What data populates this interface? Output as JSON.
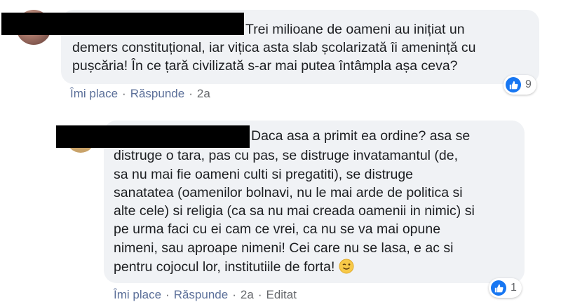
{
  "comments": [
    {
      "text_lines": [
        "Trei milioane de oameni au inițiat un",
        "demers constituțional, iar vițica asta slab școlarizată îi amenință cu",
        "pușcăria! În ce țară civilizată s-ar mai putea întâmpla așa ceva?"
      ],
      "like_label": "Îmi place",
      "reply_label": "Răspunde",
      "time": "2a",
      "reaction_count": "9",
      "reaction_icon": "like-icon"
    },
    {
      "text_lines": [
        "Daca asa a primit ea ordine? asa se",
        "distruge o tara, pas cu pas, se distruge invatamantul (de,",
        "sa nu mai fie oameni culti si pregatiti), se distruge",
        "sanatatea (oamenilor bolnavi, nu le mai arde de politica si",
        "alte cele) si religia (ca sa nu mai creada oamenii in nimic) si",
        "pe urma faci cu ei cam ce vrei, ca nu se va mai opune",
        "nimeni, sau aproape nimeni! Cei care nu se lasa, e ac si",
        "pentru cojocul lor, institutiile de forta!"
      ],
      "emoji": "wink-emoji",
      "like_label": "Îmi place",
      "reply_label": "Răspunde",
      "time": "2a",
      "edited_label": "Editat",
      "reaction_count": "1",
      "reaction_icon": "like-icon"
    }
  ],
  "colors": {
    "bubble": "#f0f2f5",
    "link": "#5b6f99",
    "meta": "#65676b",
    "like_blue": "#1877f2"
  }
}
